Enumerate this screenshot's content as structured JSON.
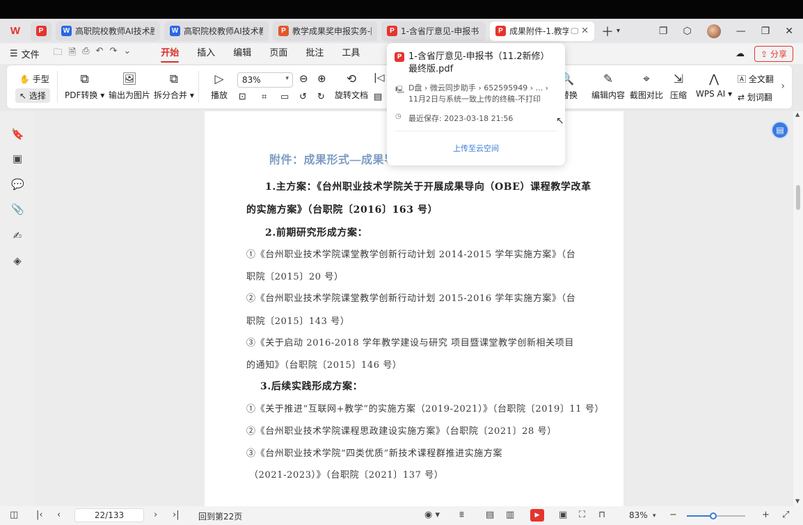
{
  "app": {
    "logo": "W"
  },
  "tabs": [
    {
      "icon": "pdf-app-icon",
      "label": "",
      "small": true
    },
    {
      "icon": "word-icon",
      "label": "高职院校教师AI技术胜任"
    },
    {
      "icon": "word-icon",
      "label": "高职院校教师AI技术教"
    },
    {
      "icon": "ppt-icon",
      "label": "教学成果奖申报实务-陈"
    },
    {
      "icon": "pdf-icon",
      "label": "1-含省厅意见-申报书（"
    },
    {
      "icon": "pdf-icon",
      "label": "成果附件-1.教学",
      "active": true
    }
  ],
  "menu": {
    "file": "文件",
    "tabs": [
      "开始",
      "插入",
      "编辑",
      "页面",
      "批注",
      "工具"
    ],
    "active": "开始",
    "share": "分享"
  },
  "ribbon": {
    "hand": "手型",
    "select": "选择",
    "pdf_convert": "PDF转换",
    "export_image": "输出为图片",
    "split_merge": "拆分合并",
    "play": "播放",
    "zoom": "83%",
    "rotate": "旋转文档",
    "find_replace": "查找替换",
    "edit_content": "编辑内容",
    "screenshot_compare": "截图对比",
    "compress": "压缩",
    "wps_ai": "WPS AI",
    "full_translate": "全文翻",
    "word_translate": "划词翻"
  },
  "popup": {
    "title": "1-含省厅意见-申报书（11.2新修）最终版.pdf",
    "path": "D盘 › 微云同步助手 › 652595949 › ... › 11月2日与系统一致上传的终稿-不打印",
    "saved": "最近保存: 2023-03-18 21:56",
    "upload": "上传至云空间"
  },
  "document": {
    "title": "附件：成果形式—成果导",
    "lines": [
      {
        "text": "1.主方案：《台州职业技术学院关于开展成果导向（OBE）课程教学改革",
        "style": "bold"
      },
      {
        "text": "的实施方案》（台职院〔2016〕163 号）",
        "style": "bold"
      },
      {
        "text": "2.前期研究形成方案：",
        "style": "bold"
      },
      {
        "text": "①《台州职业技术学院课堂教学创新行动计划 2014-2015 学年实施方案》（台",
        "style": "plain"
      },
      {
        "text": "职院〔2015〕20 号）",
        "style": "plain"
      },
      {
        "text": "②《台州职业技术学院课堂教学创新行动计划 2015-2016 学年实施方案》（台",
        "style": "plain"
      },
      {
        "text": "职院〔2015〕143 号）",
        "style": "plain"
      },
      {
        "text": "③《关于启动 2016-2018 学年教学建设与研究 项目暨课堂教学创新相关项目",
        "style": "plain"
      },
      {
        "text": "的通知》（台职院〔2015〕146 号）",
        "style": "plain"
      },
      {
        "text": "3.后续实践形成方案：",
        "style": "bold"
      },
      {
        "text": "①《关于推进“互联网+教学”的实施方案（2019-2021）》（台职院〔2019〕11 号）",
        "style": "plain"
      },
      {
        "text": "②《台州职业技术学院课程思政建设实施方案》（台职院〔2021〕28 号）",
        "style": "plain"
      },
      {
        "text": "③《台州职业技术学院“四类优质”新技术课程群推进实施方案",
        "style": "plain"
      },
      {
        "text": "（2021-2023）》（台职院〔2021〕137 号）",
        "style": "plain"
      }
    ]
  },
  "status": {
    "page": "22/133",
    "goto": "回到第22页",
    "zoom": "83%",
    "zoom_level": 0.45
  },
  "colors": {
    "accent": "#e5342e",
    "link": "#3b78d8",
    "title": "#7d9cc4"
  }
}
